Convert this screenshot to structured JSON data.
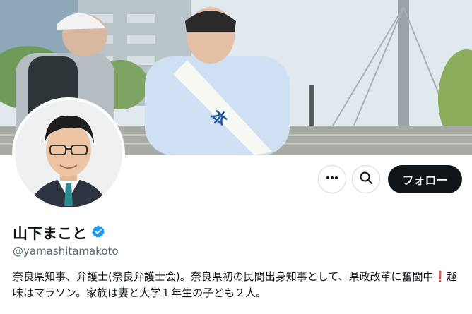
{
  "profile": {
    "display_name": "山下まこと",
    "handle": "@yamashitamakoto",
    "verified": true,
    "bio": "奈良県知事、弁護士(奈良弁護士会)。奈良県初の民間出身知事として、県政改革に奮闘中❗趣味はマラソン。家族は妻と大学１年生の子ども２人。",
    "sash_text": "本"
  },
  "actions": {
    "more_icon": "more-icon",
    "search_icon": "search-icon",
    "follow_label": "フォロー"
  },
  "colors": {
    "accent": "#1d9bf0",
    "follow_bg": "#0f1419",
    "handle_text": "#536471"
  }
}
